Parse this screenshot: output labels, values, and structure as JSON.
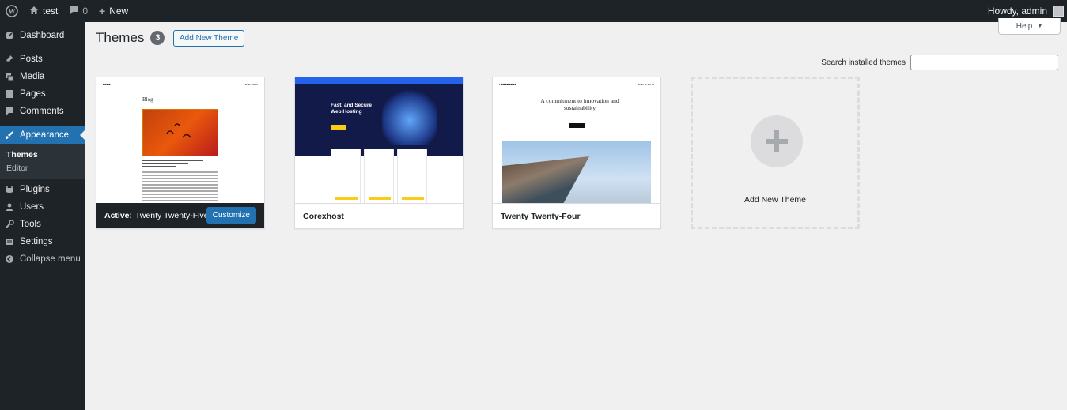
{
  "adminbar": {
    "site_name": "test",
    "comments_count": "0",
    "new_label": "New",
    "howdy": "Howdy, admin"
  },
  "sidebar": {
    "items": [
      {
        "label": "Dashboard",
        "icon": "dashboard-icon"
      },
      {
        "label": "Posts",
        "icon": "pin-icon"
      },
      {
        "label": "Media",
        "icon": "media-icon"
      },
      {
        "label": "Pages",
        "icon": "page-icon"
      },
      {
        "label": "Comments",
        "icon": "comment-icon"
      },
      {
        "label": "Appearance",
        "icon": "brush-icon"
      },
      {
        "label": "Plugins",
        "icon": "plug-icon"
      },
      {
        "label": "Users",
        "icon": "user-icon"
      },
      {
        "label": "Tools",
        "icon": "wrench-icon"
      },
      {
        "label": "Settings",
        "icon": "settings-icon"
      },
      {
        "label": "Collapse menu",
        "icon": "collapse-icon"
      }
    ],
    "submenu": [
      "Themes",
      "Editor"
    ]
  },
  "main": {
    "title": "Themes",
    "count": "3",
    "add_new_button": "Add New Theme",
    "help_label": "Help",
    "search_label": "Search installed themes",
    "search_value": ""
  },
  "themes": [
    {
      "name": "Twenty Twenty-Five",
      "active_prefix": "Active:",
      "customize": "Customize",
      "mock": {
        "blog_heading": "Blog"
      }
    },
    {
      "name": "Corexhost",
      "mock": {
        "hero_title": "Fast, and Secure Web Hosting"
      }
    },
    {
      "name": "Twenty Twenty-Four",
      "mock": {
        "hero_title": "A commitment to innovation and sustainability"
      }
    }
  ],
  "add_new_card": {
    "label": "Add New Theme"
  },
  "colors": {
    "accent": "#2271b1",
    "adminbar_bg": "#1d2327",
    "page_bg": "#f0f0f1"
  }
}
